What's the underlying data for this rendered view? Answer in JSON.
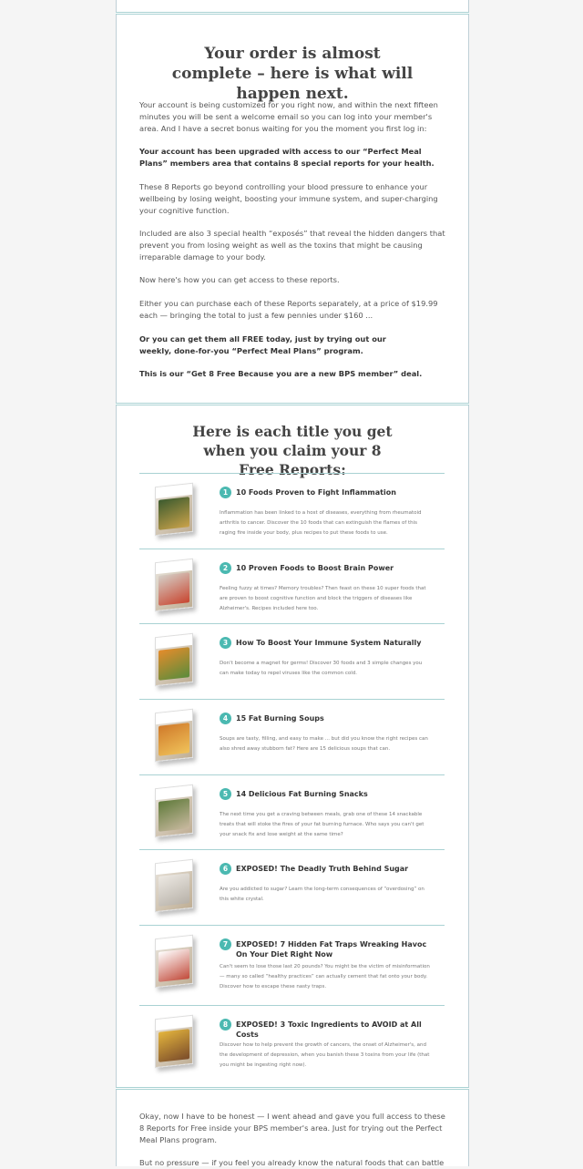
{
  "order": {
    "headline": "Your order is almost complete – here is what will happen next.",
    "p1": "Your account is being customized for you right now, and within the next fifteen minutes you will be sent a welcome email so you can log into your member's area. And I have a secret bonus waiting for you the moment you first log in:",
    "p2": "Your account has been upgraded with access to our “Perfect Meal Plans” members area that contains 8 special reports for your health.",
    "p3": "These 8 Reports go beyond controlling your blood pressure to enhance your wellbeing by losing weight, boosting your immune system, and super-charging your cognitive function.",
    "p4": "Included are also 3 special health “exposés” that reveal the hidden dangers that prevent you from losing weight as well as the toxins that might be causing irreparable damage to your body.",
    "p5": "Now here's how you can get access to these reports.",
    "p6": "Either you can purchase each of these Reports separately, at a price of $19.99 each — bringing the total to just a few pennies under $160 ...",
    "p7": "Or you can get them all FREE today, just by trying out our weekly, done-for-you “Perfect Meal Plans” program.",
    "p8": "This is our “Get 8 Free Because you are a new BPS member” deal."
  },
  "reports": {
    "headline": "Here is each title you get when you claim your 8 Free Reports:",
    "items": [
      {
        "n": "1",
        "title": "10 Foods Proven to Fight Inflammation",
        "desc": "Inflammation has been linked to a host of diseases, everything from rheumatoid arthritis to cancer. Discover the 10 foods that can extinguish the flames of this raging fire inside your body, plus recipes to put these foods to use."
      },
      {
        "n": "2",
        "title": "10 Proven Foods to Boost Brain Power",
        "desc": "Feeling fuzzy at times? Memory troubles? Then feast on these 10 super foods that are proven to boost cognitive function and block the triggers of diseases like Alzheimer's. Recipes included here too."
      },
      {
        "n": "3",
        "title": "How To Boost Your Immune System Naturally",
        "desc": "Don't become a magnet for germs! Discover 30 foods and 3 simple changes you can make today to repel viruses like the common cold."
      },
      {
        "n": "4",
        "title": "15 Fat Burning Soups",
        "desc": "Soups are tasty, filling, and easy to make ... but did you know the right recipes can also shred away stubborn fat? Here are 15 delicious soups that can."
      },
      {
        "n": "5",
        "title": "14 Delicious Fat Burning Snacks",
        "desc": "The next time you get a craving between meals, grab one of these 14 snackable treats that will stoke the fires of your fat burning furnace. Who says you can't get your snack fix and lose weight at the same time?"
      },
      {
        "n": "6",
        "title": "EXPOSED! The Deadly Truth Behind Sugar",
        "desc": "Are you addicted to sugar? Learn the long-term consequences of “overdosing” on this white crystal."
      },
      {
        "n": "7",
        "title": "EXPOSED! 7 Hidden Fat Traps Wreaking Havoc On Your Diet Right Now",
        "desc": "Can't seem to lose those last 20 pounds? You might be the victim of misinformation — many so called “healthy practices” can actually cement that fat onto your body. Discover how to escape these nasty traps."
      },
      {
        "n": "8",
        "title": "EXPOSED! 3 Toxic Ingredients to AVOID at All Costs",
        "desc": "Discover how to help prevent the growth of cancers, the onset of Alzheimer's, and the development of depression, when you banish these 3 toxins from your life (that you might be ingesting right now)."
      }
    ]
  },
  "honest": {
    "p1": "Okay, now I have to be honest — I went ahead and gave you full access to these 8 Reports for Free inside your BPS member's area. Just for trying out the Perfect Meal Plans program.",
    "p2": "But no pressure — if you feel you already know the natural foods that can battle"
  }
}
